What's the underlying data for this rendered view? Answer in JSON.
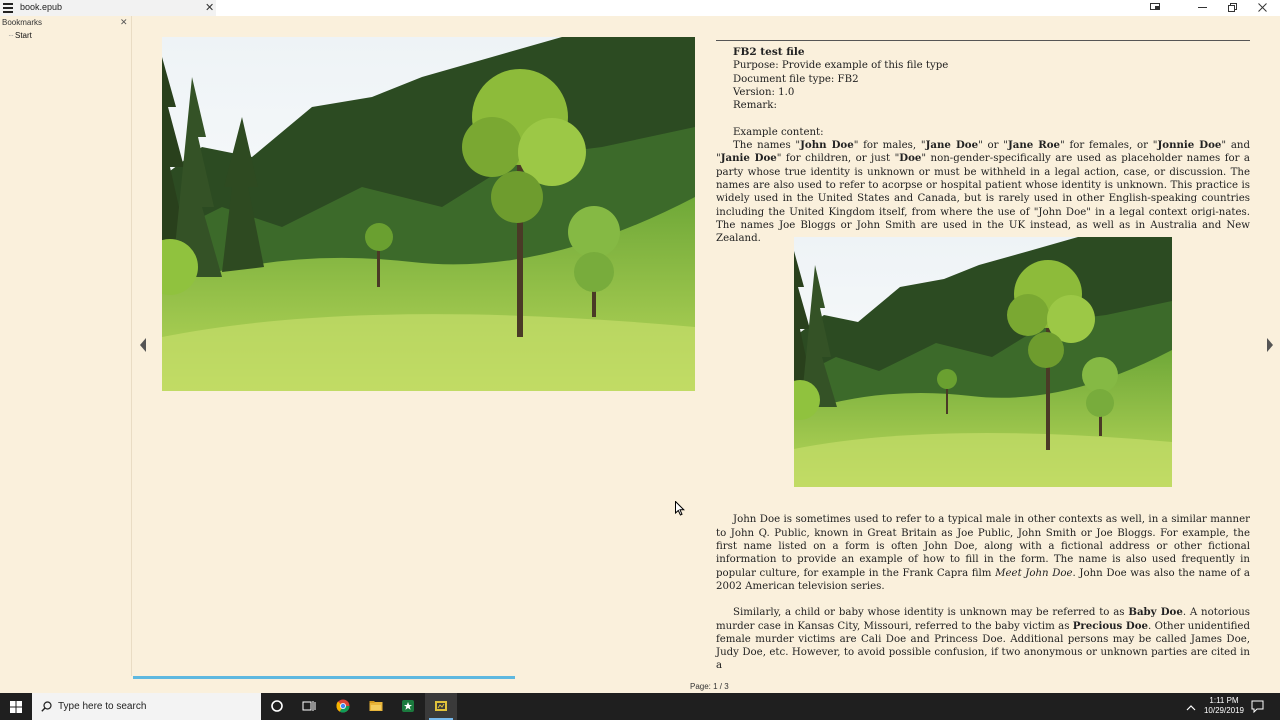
{
  "app": {
    "tab_title": "book.epub"
  },
  "sidebar": {
    "header": "Bookmarks",
    "items": [
      {
        "label": "Start"
      }
    ]
  },
  "document": {
    "title": "FB2 test file",
    "purpose": "Purpose: Provide example of this file type",
    "doc_type": "Document file type: FB2",
    "version": "Version: 1.0",
    "remark": "Remark:",
    "example_heading": "Example content:",
    "p1": [
      "The names \"",
      "John Doe",
      "\" for males, \"",
      "Jane Doe",
      "\" or \"",
      "Jane Roe",
      "\" for females, or \"",
      "Jonnie Doe",
      "\" and \"",
      "Janie Doe",
      "\" for children, or just \"",
      "Doe",
      "\" non-gender-specifically are used as placeholder names for a party whose true identity is unknown or must be withheld in a legal action, case, or discussion. The names are also used to refer to acorpse or hospital patient whose identity is unknown. This practice is widely used in the United States and Canada, but is rarely used in other English-speaking countries including the United Kingdom itself, from where the use of \"John Doe\" in a legal context origi-nates. The names Joe Bloggs or John Smith are used in the UK instead, as well as in Australia and New Zealand."
    ],
    "p2": [
      "John Doe is sometimes used to refer to a typical male in other contexts as well, in a similar manner to John Q. Public, known in Great Britain as Joe Public, John Smith or Joe Bloggs. For example, the first name listed on a form is often John Doe, along with a fictional address or other fictional information to provide an example of how to fill in the form. The name is also used frequently in popular culture, for example in the Frank Capra film ",
      "Meet John Doe",
      ". John Doe was also the name of a 2002 American television series."
    ],
    "p3": [
      "Similarly, a child or baby whose identity is unknown may be referred to as ",
      "Baby Doe",
      ". A notorious murder case in Kansas City, Missouri, referred to the baby victim as ",
      "Precious Doe",
      ". Other unidentified female murder victims are Cali Doe and Princess Doe. Additional persons may be called James Doe, Judy Doe, etc. However, to avoid possible confusion, if two anonymous or unknown parties are cited in a"
    ]
  },
  "status": {
    "page_label": "Page: 1 / 3",
    "progress": 0.333
  },
  "taskbar": {
    "search_placeholder": "Type here to search",
    "time": "1:11 PM",
    "date": "10/29/2019"
  },
  "colors": {
    "page_bg": "#faf0dc",
    "progress": "#5eb8e0",
    "taskbar": "#1f1f1f"
  }
}
